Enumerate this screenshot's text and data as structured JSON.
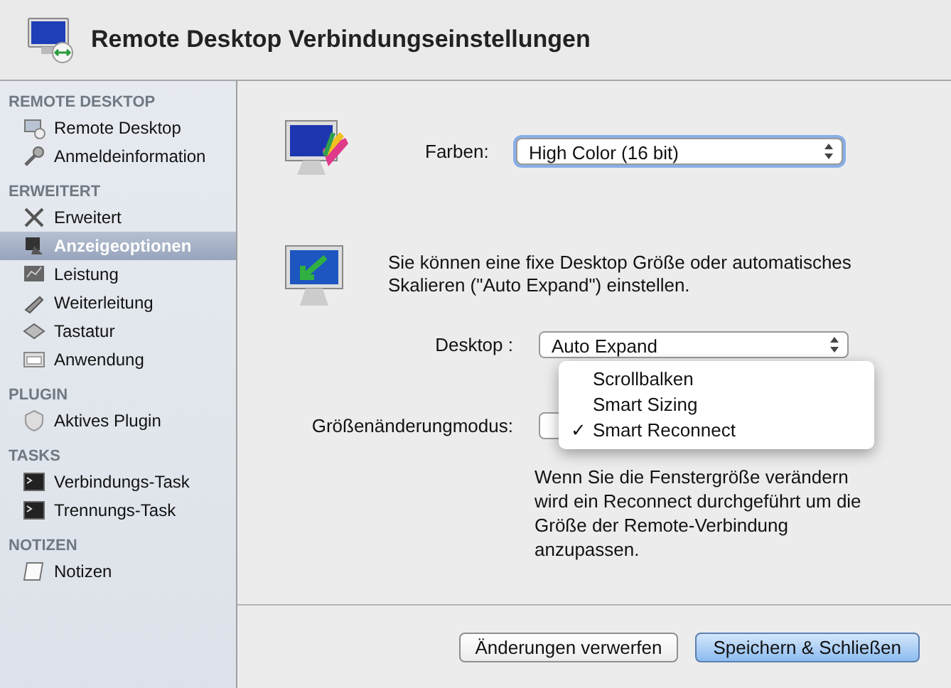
{
  "window": {
    "title": "Remote Desktop Verbindungseinstellungen"
  },
  "sidebar": {
    "sections": [
      {
        "heading": "REMOTE DESKTOP",
        "items": [
          {
            "label": "Remote Desktop",
            "selected": false
          },
          {
            "label": "Anmeldeinformation",
            "selected": false
          }
        ]
      },
      {
        "heading": "ERWEITERT",
        "items": [
          {
            "label": "Erweitert",
            "selected": false
          },
          {
            "label": "Anzeigeoptionen",
            "selected": true
          },
          {
            "label": "Leistung",
            "selected": false
          },
          {
            "label": "Weiterleitung",
            "selected": false
          },
          {
            "label": "Tastatur",
            "selected": false
          },
          {
            "label": "Anwendung",
            "selected": false
          }
        ]
      },
      {
        "heading": "PLUGIN",
        "items": [
          {
            "label": "Aktives Plugin",
            "selected": false
          }
        ]
      },
      {
        "heading": "TASKS",
        "items": [
          {
            "label": "Verbindungs-Task",
            "selected": false
          },
          {
            "label": "Trennungs-Task",
            "selected": false
          }
        ]
      },
      {
        "heading": "NOTIZEN",
        "items": [
          {
            "label": "Notizen",
            "selected": false
          }
        ]
      }
    ]
  },
  "colors": {
    "label": "Farben:",
    "value": "High Color (16 bit)"
  },
  "display": {
    "description": "Sie können eine fixe Desktop Größe oder automatisches Skalieren (\"Auto Expand\") einstellen.",
    "desktop": {
      "label": "Desktop :",
      "value": "Auto Expand"
    },
    "resize_mode": {
      "label": "Größenänderungmodus:",
      "check_mark": "✓",
      "menu": [
        {
          "label": "Scrollbalken",
          "selected": false
        },
        {
          "label": "Smart Sizing",
          "selected": false
        },
        {
          "label": "Smart Reconnect",
          "selected": true
        }
      ]
    },
    "note": "Wenn Sie die Fenstergröße verändern wird ein Reconnect durchgeführt um die Größe der Remote-Verbindung anzupassen."
  },
  "buttons": [
    {
      "label": "Änderungen verwerfen",
      "kind": "secondary"
    },
    {
      "label": "Speichern & Schließen",
      "kind": "default"
    }
  ]
}
